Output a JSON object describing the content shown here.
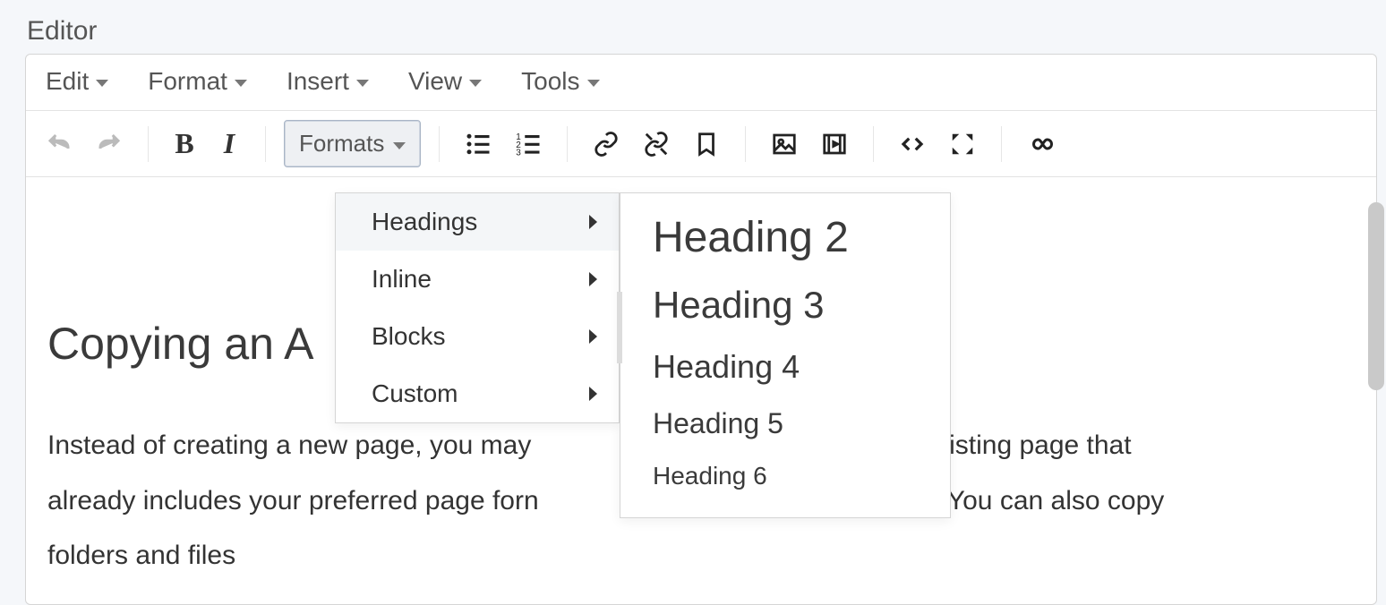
{
  "label": "Editor",
  "menubar": {
    "items": [
      "Edit",
      "Format",
      "Insert",
      "View",
      "Tools"
    ]
  },
  "toolbar": {
    "formats_label": "Formats"
  },
  "formats_menu": {
    "items": [
      {
        "label": "Headings",
        "hover": true
      },
      {
        "label": "Inline",
        "hover": false
      },
      {
        "label": "Blocks",
        "hover": false
      },
      {
        "label": "Custom",
        "hover": false
      }
    ]
  },
  "headings_menu": {
    "items": [
      {
        "label": "Heading 2",
        "size": 48
      },
      {
        "label": "Heading 3",
        "size": 42
      },
      {
        "label": "Heading 4",
        "size": 36
      },
      {
        "label": "Heading 5",
        "size": 32
      },
      {
        "label": "Heading 6",
        "size": 28
      }
    ]
  },
  "content": {
    "title": "Copying an A",
    "body_pre": "Instead of creating a new page, you may",
    "body_mid1": "f an existing page that",
    "body_line2_pre": "already includes your preferred page forn",
    "body_line2_post": "ypes. You can also copy",
    "body_line3": "folders and files"
  }
}
